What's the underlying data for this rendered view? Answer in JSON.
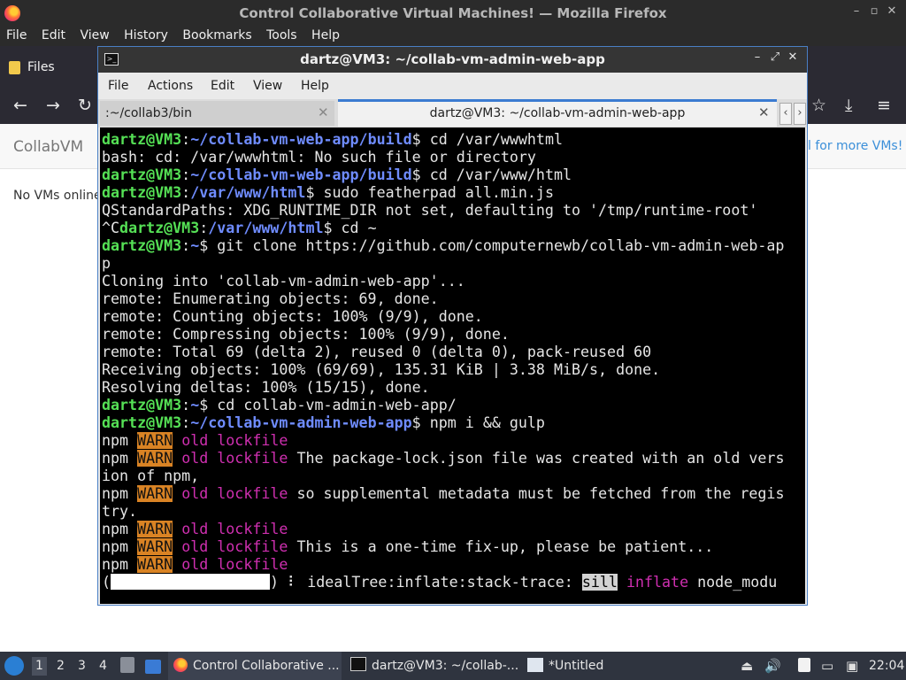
{
  "firefox": {
    "window_title": "Control Collaborative Virtual Machines! — Mozilla Firefox",
    "menu": [
      "File",
      "Edit",
      "View",
      "History",
      "Bookmarks",
      "Tools",
      "Help"
    ],
    "bookmark_folder": "Files"
  },
  "page": {
    "brand": "CollabVM",
    "more_vms_link": "l for more VMs!",
    "no_vms_text": "No VMs online"
  },
  "terminal": {
    "title": "dartz@VM3: ~/collab-vm-admin-web-app",
    "menu": [
      "File",
      "Actions",
      "Edit",
      "View",
      "Help"
    ],
    "tabs": [
      {
        "label": ":~/collab3/bin",
        "active": false
      },
      {
        "label": "dartz@VM3: ~/collab-vm-admin-web-app",
        "active": true
      }
    ],
    "lines": [
      {
        "prompt_user": "dartz@VM3",
        "prompt_path": "~/collab-vm-web-app/build",
        "cmd": " cd /var/wwwhtml"
      },
      {
        "text": "bash: cd: /var/wwwhtml: No such file or directory"
      },
      {
        "prompt_user": "dartz@VM3",
        "prompt_path": "~/collab-vm-web-app/build",
        "cmd": " cd /var/www/html"
      },
      {
        "prompt_user": "dartz@VM3",
        "prompt_path": "/var/www/html",
        "cmd": " sudo featherpad all.min.js"
      },
      {
        "text": "QStandardPaths: XDG_RUNTIME_DIR not set, defaulting to '/tmp/runtime-root'"
      },
      {
        "pre": "^C",
        "prompt_user": "dartz@VM3",
        "prompt_path": "/var/www/html",
        "cmd": " cd ~"
      },
      {
        "prompt_user": "dartz@VM3",
        "prompt_path": "~",
        "cmd": " git clone https://github.com/computernewb/collab-vm-admin-web-ap"
      },
      {
        "text": "p"
      },
      {
        "text": "Cloning into 'collab-vm-admin-web-app'..."
      },
      {
        "text": "remote: Enumerating objects: 69, done."
      },
      {
        "text": "remote: Counting objects: 100% (9/9), done."
      },
      {
        "text": "remote: Compressing objects: 100% (9/9), done."
      },
      {
        "text": "remote: Total 69 (delta 2), reused 0 (delta 0), pack-reused 60"
      },
      {
        "text": "Receiving objects: 100% (69/69), 135.31 KiB | 3.38 MiB/s, done."
      },
      {
        "text": "Resolving deltas: 100% (15/15), done."
      },
      {
        "prompt_user": "dartz@VM3",
        "prompt_path": "~",
        "cmd": " cd collab-vm-admin-web-app/"
      },
      {
        "prompt_user": "dartz@VM3",
        "prompt_path": "~/collab-vm-admin-web-app",
        "cmd": " npm i && gulp"
      },
      {
        "npm": "npm",
        "warn": "WARN",
        "kind": "old lockfile",
        "msg": ""
      },
      {
        "npm": "npm",
        "warn": "WARN",
        "kind": "old lockfile",
        "msg": " The package-lock.json file was created with an old vers"
      },
      {
        "text": "ion of npm,"
      },
      {
        "npm": "npm",
        "warn": "WARN",
        "kind": "old lockfile",
        "msg": " so supplemental metadata must be fetched from the regis"
      },
      {
        "text": "try."
      },
      {
        "npm": "npm",
        "warn": "WARN",
        "kind": "old lockfile",
        "msg": ""
      },
      {
        "npm": "npm",
        "warn": "WARN",
        "kind": "old lockfile",
        "msg": " This is a one-time fix-up, please be patient..."
      },
      {
        "npm": "npm",
        "warn": "WARN",
        "kind": "old lockfile",
        "msg": ""
      },
      {
        "progress": true,
        "spinner": "⠇",
        "stage": " idealTree:inflate:stack-trace: ",
        "level": "sill",
        "kind": "inflate",
        "tail": " node_modu"
      }
    ]
  },
  "taskbar": {
    "workspaces": [
      "1",
      "2",
      "3",
      "4"
    ],
    "tasks": [
      {
        "label": "Control Collaborative ...",
        "icon": "firefox-icon"
      },
      {
        "label": "dartz@VM3: ~/collab-...",
        "icon": "terminal-icon"
      },
      {
        "label": "*Untitled",
        "icon": "text-editor-icon"
      }
    ],
    "clock": "22:04"
  },
  "colors": {
    "prompt_user": "#55e055",
    "prompt_path": "#6f8cff",
    "warn_bg": "#d98324",
    "npm_kind": "#cf2fb0",
    "tab_accent": "#3b7bd1"
  }
}
